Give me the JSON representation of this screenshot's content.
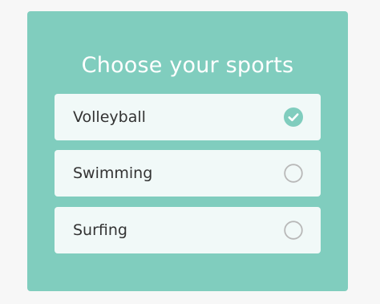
{
  "title": "Choose your sports",
  "options": [
    {
      "label": "Volleyball",
      "selected": true
    },
    {
      "label": "Swimming",
      "selected": false
    },
    {
      "label": "Surfing",
      "selected": false
    }
  ],
  "colors": {
    "page_bg": "#f7f7f7",
    "card_bg": "#80cdbe",
    "option_bg": "#f1f9f8",
    "check_fill": "#80cdbe",
    "radio_border": "#b8b8b8",
    "text": "#333333",
    "title_text": "#ffffff"
  },
  "icons": {
    "selected": "check-circle-icon",
    "unselected": "empty-circle-icon"
  }
}
